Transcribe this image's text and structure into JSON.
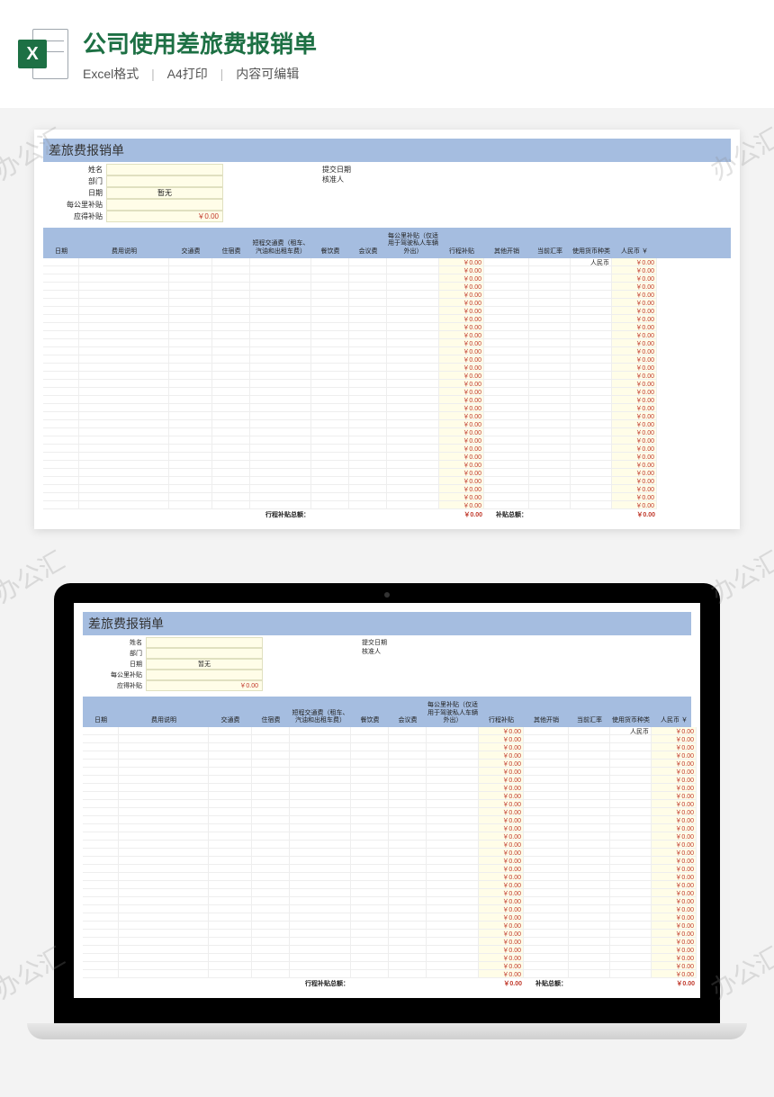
{
  "header": {
    "title": "公司使用差旅费报销单",
    "meta1": "Excel格式",
    "meta2": "A4打印",
    "meta3": "内容可编辑",
    "icon_letter": "X"
  },
  "watermark_text": "办公汇",
  "sheet": {
    "title": "差旅费报销单",
    "info": {
      "name_label": "姓名",
      "dept_label": "部门",
      "date_label": "日期",
      "date_value": "暂无",
      "perkm_label": "每公里补贴",
      "due_label": "应得补贴",
      "due_value": "￥0.00",
      "submit_date_label": "提交日期",
      "approver_label": "核准人"
    },
    "columns": {
      "c1": "日期",
      "c2": "费用说明",
      "c3": "交通费",
      "c4": "住宿费",
      "c5": "短程交通费（租车、汽油和出租车费）",
      "c6": "餐饮费",
      "c7": "会议费",
      "c8": "每公里补贴（仅适用于驾驶私人车辆外出）",
      "c9": "行程补贴",
      "c10": "其他开销",
      "c11": "当前汇率",
      "c12": "使用货币种类",
      "c13": "人民币 ￥"
    },
    "currency_default": "人民币",
    "zero_value": "￥0.00",
    "row_count": 31,
    "footer": {
      "trip_total_label": "行程补贴总额：",
      "trip_total_value": "￥0.00",
      "subsidy_total_label": "补贴总额：",
      "subsidy_total_value": "￥0.00"
    }
  }
}
